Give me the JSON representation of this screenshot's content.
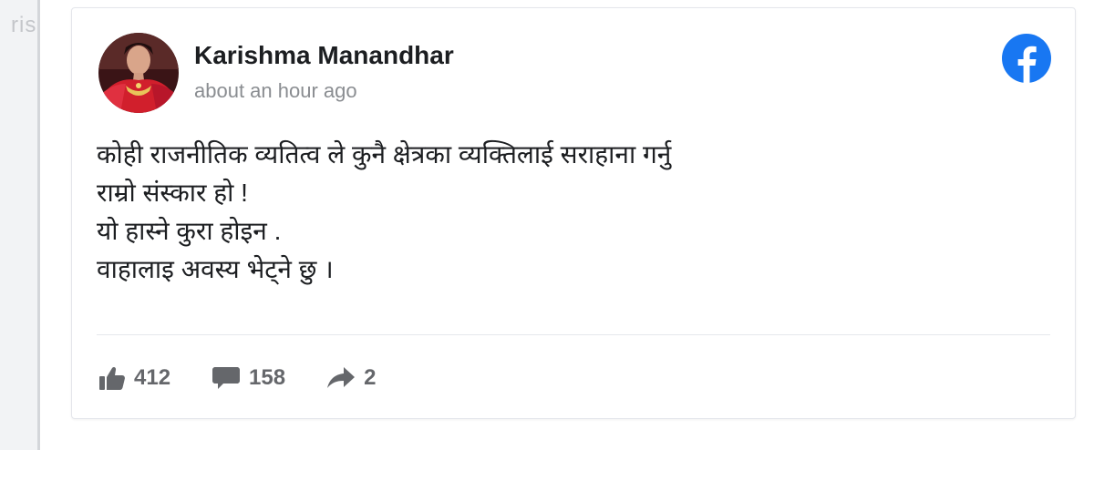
{
  "background": {
    "partial_text": "ris"
  },
  "post": {
    "author": "Karishma Manandhar",
    "timestamp": "about an hour ago",
    "lines": [
      "कोही राजनीतिक व्यतित्व ले कुनै क्षेत्रका व्यक्तिलाई सराहाना गर्नु",
      "राम्रो संस्कार हो !",
      "यो हास्ने कुरा होइन .",
      "वाहालाइ अवस्य भेट्ने छु ।"
    ],
    "reactions": {
      "likes": "412",
      "comments": "158",
      "shares": "2"
    }
  },
  "icons": {
    "platform": "facebook-logo-icon",
    "like": "thumbs-up-icon",
    "comment": "comment-bubble-icon",
    "share": "share-arrow-icon"
  },
  "colors": {
    "facebook_blue": "#1877f2",
    "text_primary": "#1c1e21",
    "text_secondary": "#65676b",
    "timestamp": "#8a8d91"
  }
}
